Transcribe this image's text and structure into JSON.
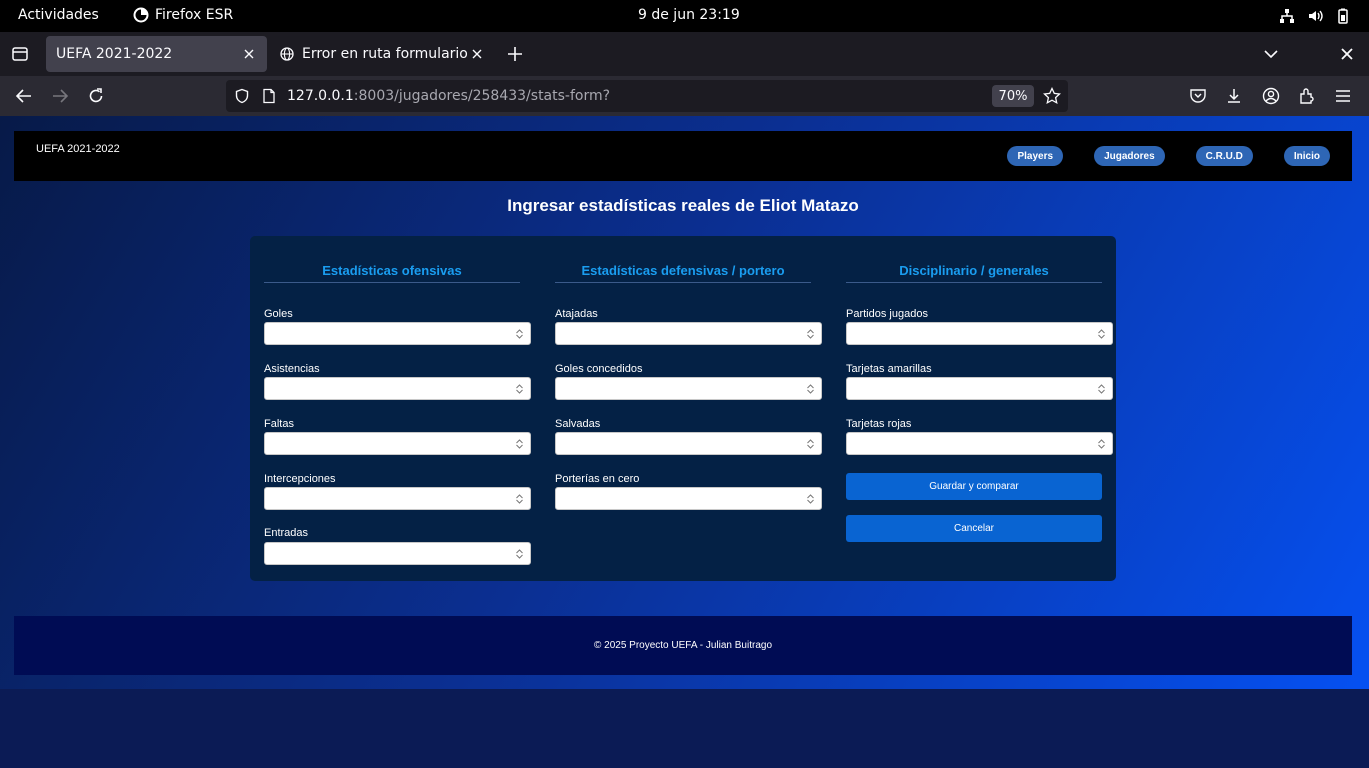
{
  "system_bar": {
    "activities": "Actividades",
    "app_name": "Firefox ESR",
    "clock": "9 de jun  23:19"
  },
  "browser": {
    "tabs": [
      {
        "title": "UEFA 2021-2022",
        "active": true
      },
      {
        "title": "Error en ruta formulario",
        "active": false
      }
    ],
    "url": {
      "host": "127.0.0.1",
      "rest": ":8003/jugadores/258433/stats-form?"
    },
    "zoom": "70%"
  },
  "site": {
    "brand": "UEFA 2021-2022",
    "nav": [
      "Players",
      "Jugadores",
      "C.R.U.D",
      "Inicio"
    ],
    "heading": "Ingresar estadísticas reales de Eliot Matazo",
    "columns": [
      {
        "title": "Estadísticas ofensivas",
        "fields": [
          {
            "label": "Goles",
            "value": ""
          },
          {
            "label": "Asistencias",
            "value": ""
          },
          {
            "label": "Faltas",
            "value": ""
          },
          {
            "label": "Intercepciones",
            "value": ""
          },
          {
            "label": "Entradas",
            "value": ""
          }
        ]
      },
      {
        "title": "Estadísticas defensivas / portero",
        "fields": [
          {
            "label": "Atajadas",
            "value": ""
          },
          {
            "label": "Goles concedidos",
            "value": ""
          },
          {
            "label": "Salvadas",
            "value": ""
          },
          {
            "label": "Porterías en cero",
            "value": ""
          }
        ]
      },
      {
        "title": "Disciplinario / generales",
        "fields": [
          {
            "label": "Partidos jugados",
            "value": ""
          },
          {
            "label": "Tarjetas amarillas",
            "value": ""
          },
          {
            "label": "Tarjetas rojas",
            "value": ""
          }
        ]
      }
    ],
    "buttons": {
      "save": "Guardar y comparar",
      "cancel": "Cancelar"
    },
    "footer": "© 2025 Proyecto UEFA - Julian Buitrago"
  },
  "colors": {
    "header_bg": "#000000",
    "nav_pill": "#2e66b5",
    "card_bg": "#042145",
    "column_title": "#1a9df0",
    "button": "#0964d2",
    "footer_bg": "#000c54"
  }
}
